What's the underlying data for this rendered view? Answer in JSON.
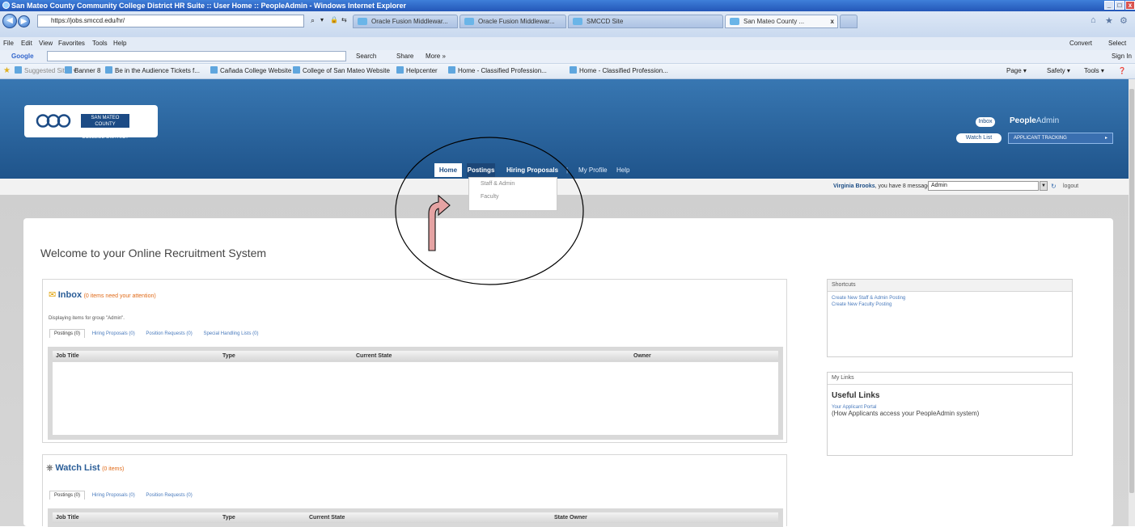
{
  "window": {
    "title": "San Mateo County Community College District HR Suite :: User Home :: PeopleAdmin - Windows Internet Explorer",
    "controls": [
      "_",
      "□",
      "x"
    ]
  },
  "browser": {
    "address": "https://jobs.smccd.edu/hr/",
    "address_icons": [
      "⌕",
      "▾",
      "🔒",
      "⇆"
    ],
    "tabs": [
      {
        "label": "Oracle Fusion Middlewar..."
      },
      {
        "label": "Oracle Fusion Middlewar..."
      },
      {
        "label": "SMCCD Site"
      },
      {
        "label": "San Mateo County ..."
      }
    ],
    "tab_close": "x",
    "menu": [
      "File",
      "Edit",
      "View",
      "Favorites",
      "Tools",
      "Help"
    ],
    "convert_label": "Convert",
    "select_label": "Select",
    "google_label": "Google",
    "search_label": "Search",
    "share_label": "Share",
    "more_label": "More »",
    "signin_label": "Sign In",
    "favorites": [
      {
        "label": "Suggested Sites ▾"
      },
      {
        "label": "Banner 8"
      },
      {
        "label": "Be in the Audience Tickets f..."
      },
      {
        "label": "Cañada College Website"
      },
      {
        "label": "College of San Mateo Website"
      },
      {
        "label": "Helpcenter"
      },
      {
        "label": "Home - Classified Profession..."
      },
      {
        "label": "Home - Classified Profession..."
      }
    ],
    "command_bar": {
      "page": "Page ▾",
      "safety": "Safety ▾",
      "tools": "Tools ▾",
      "help": "❓"
    }
  },
  "header": {
    "logo_text": "SAN MATEO COUNTY COMMUNITY COLLEGE DISTRICT",
    "inbox_pill": "Inbox",
    "watchlist_pill": "Watch List",
    "brand_people": "People",
    "brand_admin": "Admin",
    "module": "APPLICANT TRACKING",
    "nav": {
      "home": "Home",
      "postings": "Postings",
      "hiring": "Hiring Proposals",
      "separator": "|",
      "profile": "My Profile",
      "help": "Help"
    },
    "postings_menu": [
      "Staff & Admin",
      "Faculty"
    ]
  },
  "userbar": {
    "name": "Virginia Brooks",
    "greeting_suffix": ", you have 8 messages",
    "group": "Admin",
    "logout": "logout"
  },
  "main": {
    "welcome": "Welcome to your Online Recruitment System",
    "inbox": {
      "title": "Inbox",
      "subtitle": "(0 items need your attention)",
      "group_note": "Displaying items for group \"Admin\".",
      "tabs": [
        "Postings (0)",
        "Hiring Proposals (0)",
        "Position Requests (0)",
        "Special Handling Lists (0)"
      ],
      "columns": [
        "Job Title",
        "Type",
        "Current State",
        "Owner"
      ]
    },
    "watchlist": {
      "title": "Watch List",
      "subtitle": "(0 items)",
      "tabs": [
        "Postings (0)",
        "Hiring Proposals (0)",
        "Position Requests (0)"
      ],
      "columns": [
        "Job Title",
        "Type",
        "Current State",
        "State Owner"
      ]
    }
  },
  "sidebar": {
    "shortcuts": {
      "title": "Shortcuts",
      "links": [
        "Create New Staff & Admin Posting",
        "Create New Faculty Posting"
      ]
    },
    "mylinks": {
      "title": "My Links",
      "heading": "Useful Links",
      "link": "Your Applicant Portal",
      "note": "(How Applicants access your PeopleAdmin system)"
    }
  },
  "colors": {
    "header_blue": "#2a62a0",
    "nav_dark": "#1c4677",
    "accent_orange": "#e06a18",
    "link_blue": "#4a7bbd",
    "arrow_pink": "#e5a3a3"
  }
}
